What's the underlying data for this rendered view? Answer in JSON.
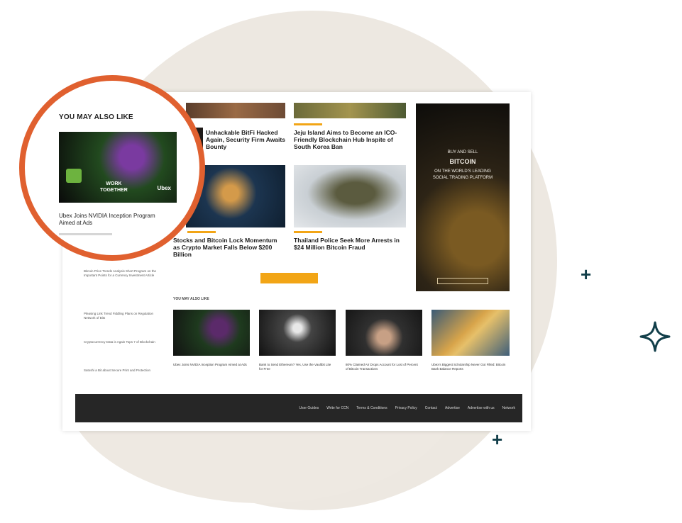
{
  "lens": {
    "title": "YOU MAY ALSO LIKE",
    "image_text_line1": "WORK",
    "image_text_line2": "TOGETHER",
    "image_brand": "Ubex",
    "caption": "Ubex Joins NVIDIA Inception Program Aimed at Ads"
  },
  "articles": {
    "top_left": "Unhackable BitFi Hacked Again, Security Firm Awaits Bounty",
    "top_right": "Jeju Island Aims to Become an ICO-Friendly Blockchain Hub Inspite of South Korea Ban",
    "mid_left": "Stocks and Bitcoin Lock Momentum as Crypto Market Falls Below $200 Billion",
    "mid_right": "Thailand Police Seek More Arrests in $24 Million Bitcoin Fraud"
  },
  "ad": {
    "line1": "BUY AND SELL",
    "line2": "BITCOIN",
    "line3": "ON THE WORLD'S LEADING SOCIAL TRADING PLATFORM"
  },
  "bottom": {
    "section_label": "YOU MAY ALSO LIKE",
    "captions": [
      "Ubex Joins NVIDIA Inception Program Aimed at Ads",
      "Bank to Send Ethereum? Yes, Use the Vaultbit Lite for Free",
      "80% Claimed Air Drops Account for Lost of Percent of Bitcoin Transactions",
      "Ubex's Biggest Scholarship Never Got Filled: Bitcoin Bank Balance Reports"
    ]
  },
  "sidebar": {
    "items": [
      "Bitcoin Price Trends Analysis Short Program on the Important Points for a Currency Investment Article",
      "Pleasing Link Trend Fiddling Plans on Regulation Network of Bits",
      "Cryptocurrency Data is Again Tops 7 of Blockchain",
      "Satoshi a Bit about Secure Print and Protection"
    ]
  },
  "footer": {
    "links": [
      "User Guides",
      "Write for CCN",
      "Terms & Conditions",
      "Privacy Policy",
      "Contact",
      "Advertise",
      "Advertise with us",
      "Network"
    ]
  },
  "colors": {
    "accent_orange": "#e0602f",
    "kicker_yellow": "#f2a516",
    "sparkle": "#123f4a",
    "blob": "#ede8e1"
  }
}
